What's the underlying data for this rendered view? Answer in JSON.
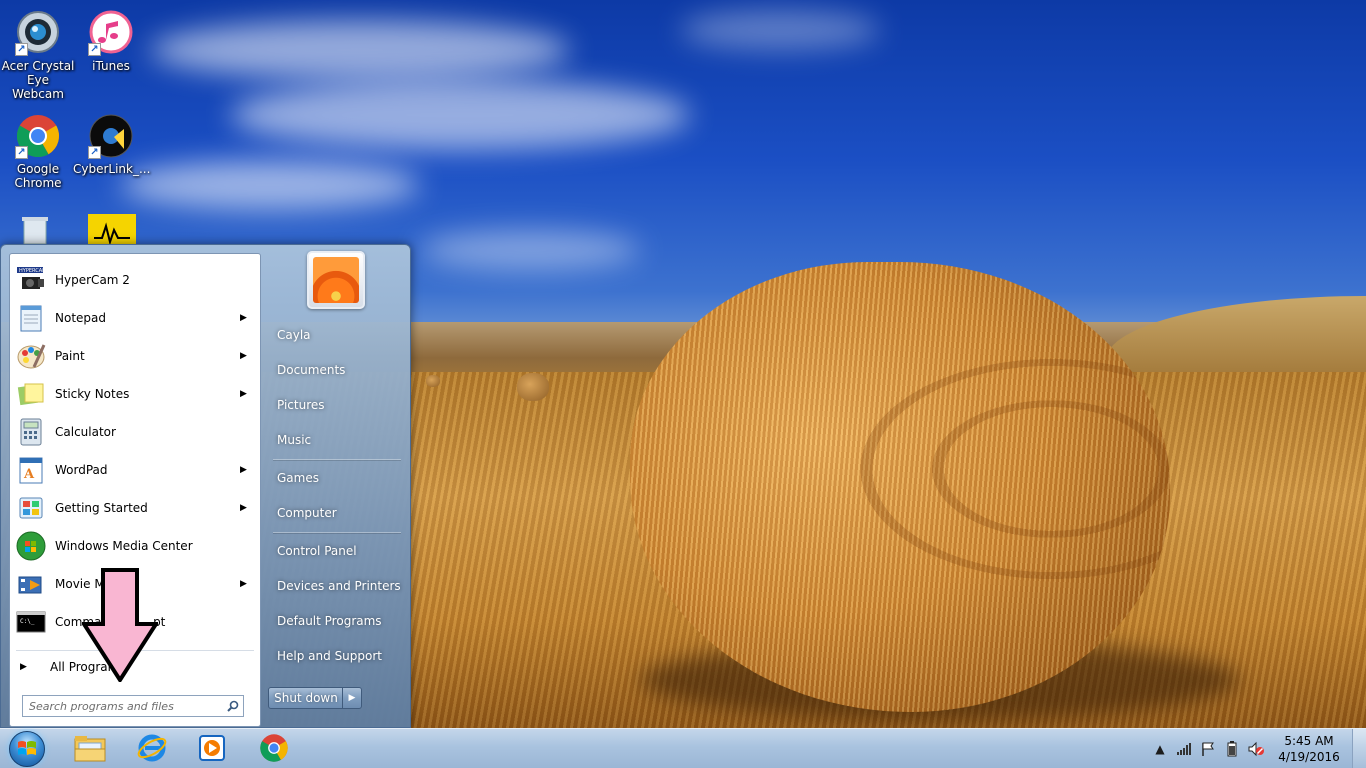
{
  "desktop": {
    "icons": [
      {
        "label_line1": "Acer Crystal",
        "label_line2": "Eye Webcam",
        "icon": "webcam-icon"
      },
      {
        "label_line1": "iTunes",
        "label_line2": "",
        "icon": "itunes-icon"
      },
      {
        "label_line1": "Google",
        "label_line2": "Chrome",
        "icon": "chrome-icon"
      },
      {
        "label_line1": "CyberLink_...",
        "label_line2": "",
        "icon": "cyberlink-icon"
      }
    ]
  },
  "start_menu": {
    "programs": [
      {
        "label": "HyperCam 2",
        "icon": "hypercam-icon",
        "has_submenu": false
      },
      {
        "label": "Notepad",
        "icon": "notepad-icon",
        "has_submenu": true
      },
      {
        "label": "Paint",
        "icon": "paint-icon",
        "has_submenu": true
      },
      {
        "label": "Sticky Notes",
        "icon": "sticky-notes-icon",
        "has_submenu": true
      },
      {
        "label": "Calculator",
        "icon": "calculator-icon",
        "has_submenu": false
      },
      {
        "label": "WordPad",
        "icon": "wordpad-icon",
        "has_submenu": true
      },
      {
        "label": "Getting Started",
        "icon": "getting-started-icon",
        "has_submenu": true
      },
      {
        "label": "Windows Media Center",
        "icon": "media-center-icon",
        "has_submenu": false
      },
      {
        "label": "Movie Ma",
        "icon": "movie-maker-icon",
        "has_submenu": true
      },
      {
        "label": "Comman",
        "label_tail": "pt",
        "icon": "command-prompt-icon",
        "has_submenu": false
      }
    ],
    "all_programs": "All Program",
    "search_placeholder": "Search programs and files",
    "right_links": [
      "Cayla",
      "Documents",
      "Pictures",
      "Music",
      "Games",
      "Computer",
      "Control Panel",
      "Devices and Printers",
      "Default Programs",
      "Help and Support"
    ],
    "shutdown_label": "Shut down"
  },
  "taskbar": {
    "pinned": [
      "explorer-icon",
      "internet-explorer-icon",
      "media-player-icon",
      "chrome-icon"
    ],
    "tray_icons": [
      "show-hidden-icons-icon",
      "network-signal-icon",
      "action-center-flag-icon",
      "battery-icon",
      "volume-muted-icon"
    ],
    "clock_time": "5:45 AM",
    "clock_date": "4/19/2016"
  },
  "colors": {
    "start_menu_glass": "#8fa9c8",
    "annotation_arrow": "#f9b6d2",
    "taskbar": "#b2c9e2"
  }
}
